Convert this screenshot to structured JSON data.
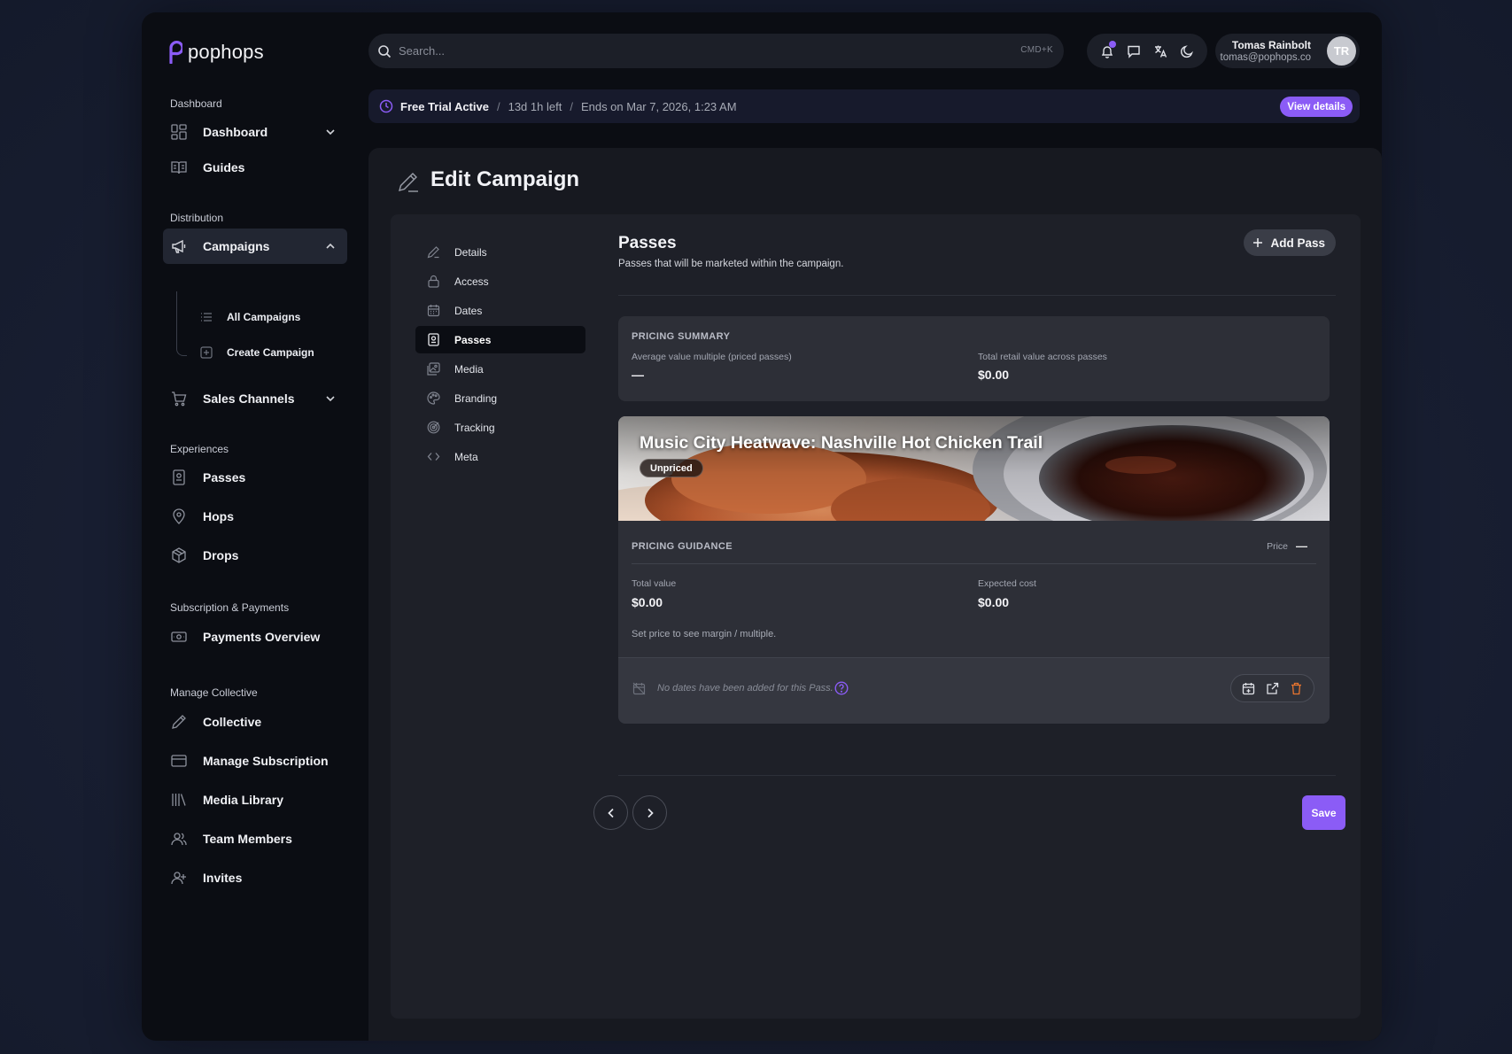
{
  "brand": {
    "name": "pophops",
    "accent": "#8b5cf6"
  },
  "sidebar": {
    "sections": {
      "dashboard": "Dashboard",
      "distribution": "Distribution",
      "experiences": "Experiences",
      "payments": "Subscription & Payments",
      "collective": "Manage Collective"
    },
    "items": {
      "dashboard": "Dashboard",
      "guides": "Guides",
      "campaigns": "Campaigns",
      "all_campaigns": "All Campaigns",
      "create_campaign": "Create Campaign",
      "sales_channels": "Sales Channels",
      "passes": "Passes",
      "hops": "Hops",
      "drops": "Drops",
      "payments_overview": "Payments Overview",
      "collective": "Collective",
      "manage_subscription": "Manage Subscription",
      "media_library": "Media Library",
      "team_members": "Team Members",
      "invites": "Invites"
    }
  },
  "header": {
    "search_placeholder": "Search...",
    "search_shortcut": "CMD+K",
    "user": {
      "name": "Tomas Rainbolt",
      "email": "tomas@pophops.co",
      "initials": "TR"
    }
  },
  "trial": {
    "status": "Free Trial Active",
    "remaining": "13d 1h left",
    "ends": "Ends on Mar 7, 2026, 1:23 AM",
    "separator": "/",
    "button": "View details"
  },
  "page": {
    "title": "Edit Campaign"
  },
  "subnav": {
    "details": "Details",
    "access": "Access",
    "dates": "Dates",
    "passes": "Passes",
    "media": "Media",
    "branding": "Branding",
    "tracking": "Tracking",
    "meta": "Meta"
  },
  "passes": {
    "title": "Passes",
    "subtitle": "Passes that will be marketed within the campaign.",
    "add_button": "Add Pass",
    "summary": {
      "heading": "PRICING SUMMARY",
      "avg_label": "Average value multiple (priced passes)",
      "avg_value": "—",
      "total_label": "Total retail value across passes",
      "total_value": "$0.00"
    },
    "pass": {
      "title": "Music City Heatwave: Nashville Hot Chicken Trail",
      "badge": "Unpriced",
      "guidance_heading": "PRICING GUIDANCE",
      "price_label": "Price",
      "price_value": "—",
      "total_value_label": "Total value",
      "total_value": "$0.00",
      "expected_cost_label": "Expected cost",
      "expected_cost": "$0.00",
      "hint": "Set price to see margin / multiple.",
      "no_dates": "No dates have been added for this Pass."
    }
  },
  "footer": {
    "save": "Save"
  }
}
